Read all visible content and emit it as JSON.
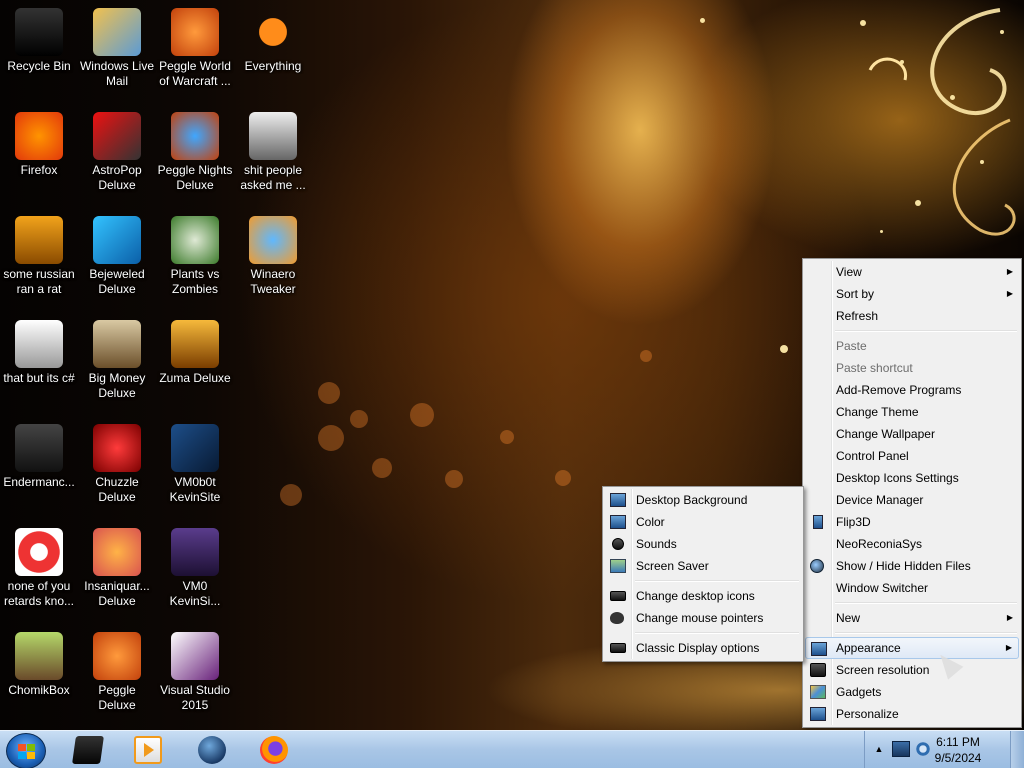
{
  "desktop_icons": [
    {
      "label": "Recycle Bin",
      "icon": "recycle-bin-icon",
      "name": "desktop-icon-recycle-bin"
    },
    {
      "label": "Windows Live\nMail",
      "icon": "mail-icon",
      "name": "desktop-icon-windows-live-mail"
    },
    {
      "label": "Peggle World\nof Warcraft ...",
      "icon": "peggle-icon",
      "name": "desktop-icon-peggle-wow"
    },
    {
      "label": "Everything",
      "icon": "search-icon",
      "name": "desktop-icon-everything"
    },
    {
      "label": "Firefox",
      "icon": "firefox-icon",
      "name": "desktop-icon-firefox"
    },
    {
      "label": "AstroPop\nDeluxe",
      "icon": "astropop-icon",
      "name": "desktop-icon-astropop"
    },
    {
      "label": "Peggle Nights\nDeluxe",
      "icon": "peggle-nights-icon",
      "name": "desktop-icon-peggle-nights"
    },
    {
      "label": "shit people\nasked me ...",
      "icon": "folder-icon",
      "name": "desktop-icon-folder-asked"
    },
    {
      "label": "some russian\nran a rat",
      "icon": "notepad-icon",
      "name": "desktop-icon-russian-rat"
    },
    {
      "label": "Bejeweled\nDeluxe",
      "icon": "bejeweled-icon",
      "name": "desktop-icon-bejeweled"
    },
    {
      "label": "Plants vs\nZombies",
      "icon": "plants-icon",
      "name": "desktop-icon-plants-vs-zombies"
    },
    {
      "label": "Winaero\nTweaker",
      "icon": "winaero-icon",
      "name": "desktop-icon-winaero"
    },
    {
      "label": "that but its c#",
      "icon": "shortcut-icon",
      "name": "desktop-icon-that-but-csharp"
    },
    {
      "label": "Big Money\nDeluxe",
      "icon": "big-money-icon",
      "name": "desktop-icon-big-money"
    },
    {
      "label": "Zuma Deluxe",
      "icon": "zuma-icon",
      "name": "desktop-icon-zuma"
    },
    {
      "label": "",
      "icon": "",
      "name": ""
    },
    {
      "label": "Endermanc...",
      "icon": "terminal-icon",
      "name": "desktop-icon-endermanc"
    },
    {
      "label": "Chuzzle\nDeluxe",
      "icon": "chuzzle-icon",
      "name": "desktop-icon-chuzzle"
    },
    {
      "label": "VM0b0t\nKevinSite",
      "icon": "vm-icon",
      "name": "desktop-icon-vm0b0t"
    },
    {
      "label": "",
      "icon": "",
      "name": ""
    },
    {
      "label": "none of you\nretards kno...",
      "icon": "chrome-icon",
      "name": "desktop-icon-none-of-you"
    },
    {
      "label": "Insaniquar...\nDeluxe",
      "icon": "fish-icon",
      "name": "desktop-icon-insaniquarium"
    },
    {
      "label": "VM0\nKevinSi...",
      "icon": "document-icon",
      "name": "desktop-icon-vm0-kevinsite"
    },
    {
      "label": "",
      "icon": "",
      "name": ""
    },
    {
      "label": "ChomikBox",
      "icon": "chomikbox-icon",
      "name": "desktop-icon-chomikbox"
    },
    {
      "label": "Peggle Deluxe",
      "icon": "peggle-deluxe-icon",
      "name": "desktop-icon-peggle-deluxe"
    },
    {
      "label": "Visual Studio\n2015",
      "icon": "visual-studio-icon",
      "name": "desktop-icon-visual-studio"
    }
  ],
  "context_menu": {
    "view": "View",
    "sort_by": "Sort by",
    "refresh": "Refresh",
    "paste": "Paste",
    "paste_shortcut": "Paste shortcut",
    "add_remove": "Add-Remove Programs",
    "change_theme": "Change Theme",
    "change_wallpaper": "Change Wallpaper",
    "control_panel": "Control Panel",
    "desktop_icons_settings": "Desktop Icons Settings",
    "device_manager": "Device Manager",
    "flip3d": "Flip3D",
    "neoreconia": "NeoReconiaSys",
    "show_hide": "Show / Hide Hidden Files",
    "window_switcher": "Window Switcher",
    "new": "New",
    "appearance": "Appearance",
    "screen_resolution": "Screen resolution",
    "gadgets": "Gadgets",
    "personalize": "Personalize",
    "arrow": "▶"
  },
  "appearance_submenu": {
    "desktop_background": "Desktop Background",
    "color": "Color",
    "sounds": "Sounds",
    "screen_saver": "Screen Saver",
    "change_desktop_icons": "Change desktop icons",
    "change_mouse_pointers": "Change mouse pointers",
    "classic_display": "Classic Display options"
  },
  "taskbar": {
    "apps": [
      "media-player-icon",
      "video-player-icon",
      "globe-browser-icon",
      "firefox-icon"
    ],
    "tray_expand": "▲",
    "time": "6:11 PM",
    "date": "9/5/2024"
  },
  "colors": {
    "menu_bg": "#f0f0f0",
    "highlight_border": "#a8c8ea",
    "taskbar": "#a9c6e6"
  }
}
